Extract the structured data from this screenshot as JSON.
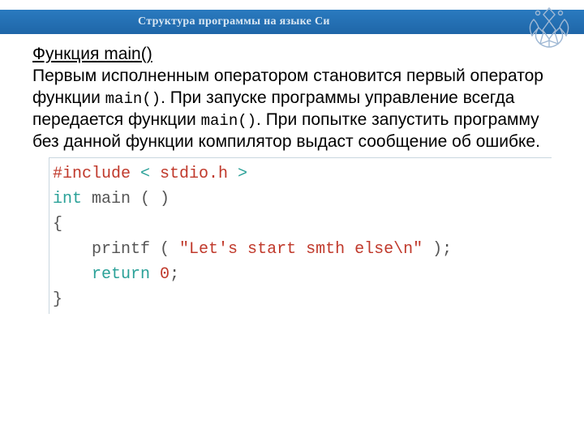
{
  "header": {
    "title": "Структура программы на языке Си"
  },
  "text": {
    "heading": "Функция main()",
    "p1a": "Первым исполненным оператором становится первый оператор функции ",
    "p1_mono1": "main()",
    "p1b": ". При запуске программы управление всегда передается функции ",
    "p1_mono2": "main()",
    "p1c": ". При попытке запустить программу без данной функции компилятор выдаст сообщение об ошибке."
  },
  "code": {
    "l1_pp": "#include",
    "l1_lt": " < ",
    "l1_hdr": "stdio.h",
    "l1_gt": " >",
    "l2_kw": "int",
    "l2_fn": " main ",
    "l2_par": "( )",
    "l3": "{",
    "l4_indent": "    ",
    "l4_fn": "printf ",
    "l4_op": "( ",
    "l4_str": "\"Let's start smth else\\n\"",
    "l4_cl": " );",
    "l5_indent": "    ",
    "l5_kw": "return",
    "l5_sp": " ",
    "l5_num": "0",
    "l5_sc": ";",
    "l6": "}"
  }
}
